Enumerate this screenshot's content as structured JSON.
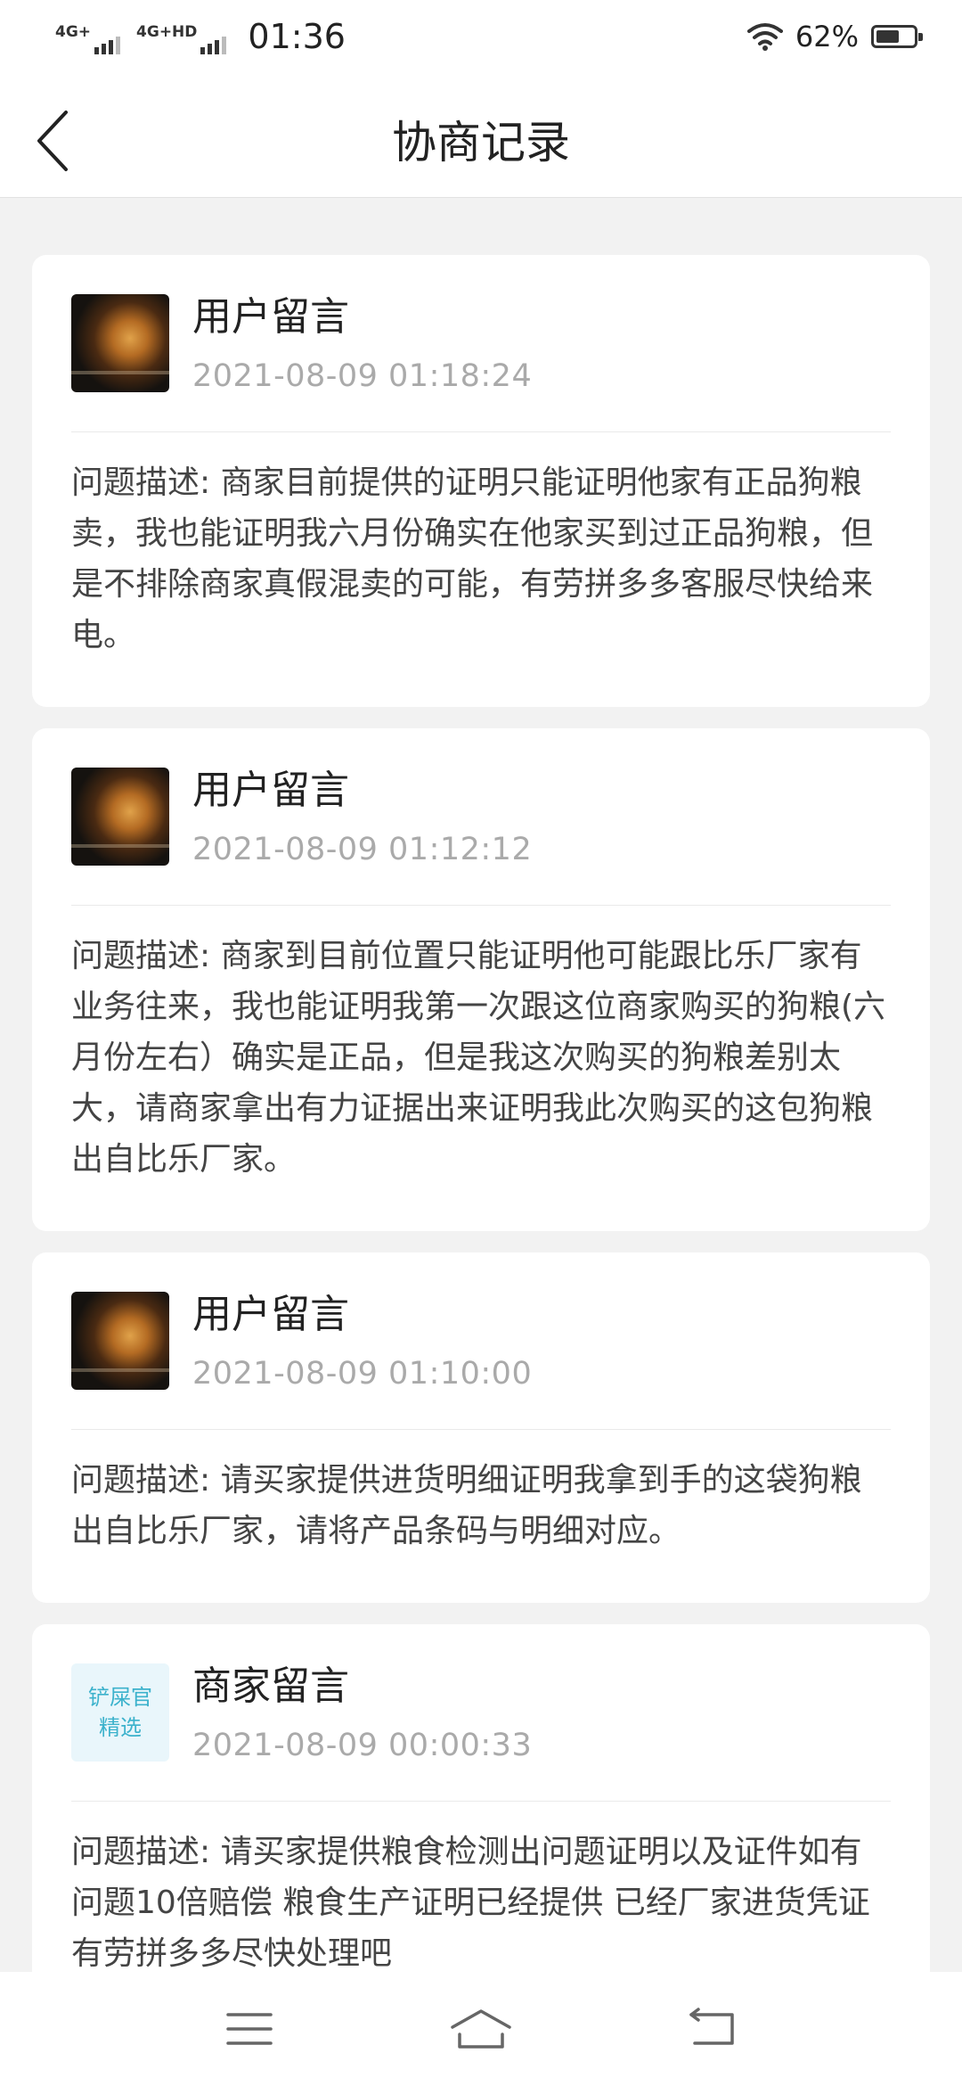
{
  "status_bar": {
    "signal1_label": "4G+",
    "signal2_label": "4G+HD",
    "time": "01:36",
    "battery_percent": "62%",
    "battery_level": 0.62
  },
  "header": {
    "title": "协商记录",
    "back_icon": "chevron-left-icon"
  },
  "records": [
    {
      "author": "用户留言",
      "timestamp": "2021-08-09 01:18:24",
      "avatar": "user-avatar",
      "message": "问题描述: 商家目前提供的证明只能证明他家有正品狗粮卖，我也能证明我六月份确实在他家买到过正品狗粮，但是不排除商家真假混卖的可能，有劳拼多多客服尽快给来电。"
    },
    {
      "author": "用户留言",
      "timestamp": "2021-08-09 01:12:12",
      "avatar": "user-avatar",
      "message": "问题描述: 商家到目前位置只能证明他可能跟比乐厂家有业务往来，我也能证明我第一次跟这位商家购买的狗粮(六月份左右）确实是正品，但是我这次购买的狗粮差别太大，请商家拿出有力证据出来证明我此次购买的这包狗粮出自比乐厂家。"
    },
    {
      "author": "用户留言",
      "timestamp": "2021-08-09 01:10:00",
      "avatar": "user-avatar",
      "message": "问题描述: 请买家提供进货明细证明我拿到手的这袋狗粮出自比乐厂家，请将产品条码与明细对应。"
    },
    {
      "author": "商家留言",
      "timestamp": "2021-08-09 00:00:33",
      "avatar": "shop-logo",
      "shop_logo_line1": "铲屎官",
      "shop_logo_line2": "精选",
      "message": "问题描述: 请买家提供粮食检测出问题证明以及证件如有问题10倍赔偿 粮食生产证明已经提供 已经厂家进货凭证 有劳拼多多尽快处理吧"
    }
  ],
  "system_nav": {
    "menu_icon": "menu-icon",
    "home_icon": "home-icon",
    "back_icon": "back-icon"
  }
}
